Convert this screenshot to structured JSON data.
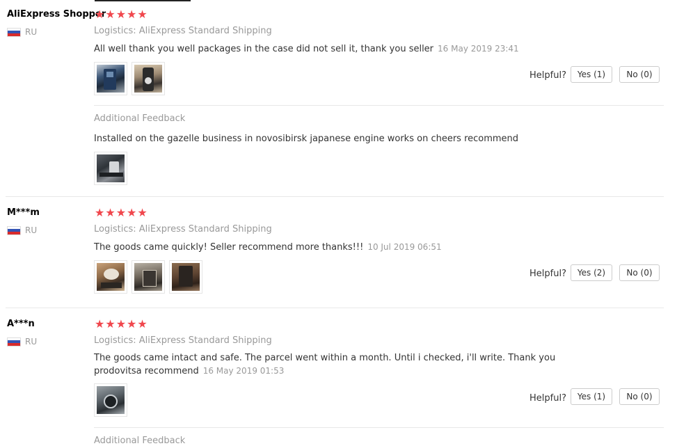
{
  "helpful_label": "Helpful?",
  "logistics_label": "Logistics:",
  "additional_feedback_label": "Additional Feedback",
  "star_glyph": "★",
  "star_color": "#f0474d",
  "reviews": [
    {
      "user": "AliExpress Shopper",
      "country": "RU",
      "rating": 5,
      "logistics": "AliExpress Standard Shipping",
      "text": "All well thank you well packages in the case did not sell it, thank you seller",
      "date": "16 May 2019 23:41",
      "image_count": 2,
      "yes": "Yes (1)",
      "no": "No (0)",
      "additional_text": "Installed on the gazelle business in novosibirsk japanese engine works on cheers recommend",
      "additional_image_count": 1
    },
    {
      "user": "M***m",
      "country": "RU",
      "rating": 5,
      "logistics": "AliExpress Standard Shipping",
      "text": "The goods came quickly! Seller recommend more thanks!!!",
      "date": "10 Jul 2019 06:51",
      "image_count": 3,
      "yes": "Yes (2)",
      "no": "No (0)"
    },
    {
      "user": "A***n",
      "country": "RU",
      "rating": 5,
      "logistics": "AliExpress Standard Shipping",
      "text": "The goods came intact and safe. The parcel went within a month. Until i checked, i'll write. Thank you prodovitsa recommend",
      "date": "16 May 2019 01:53",
      "image_count": 1,
      "yes": "Yes (1)",
      "no": "No (0)"
    }
  ]
}
